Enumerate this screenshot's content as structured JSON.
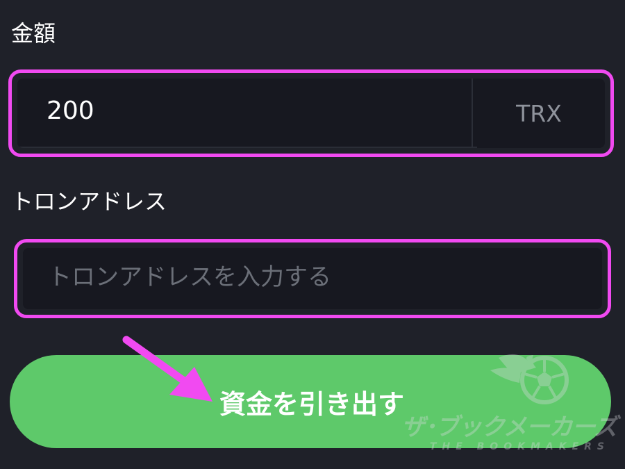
{
  "amount": {
    "label": "金額",
    "value": "200",
    "unit": "TRX"
  },
  "address": {
    "label": "トロンアドレス",
    "placeholder": "トロンアドレスを入力する",
    "value": ""
  },
  "withdraw_button": {
    "label": "資金を引き出す"
  },
  "watermark": {
    "title": "ザ･ブックメーカーズ",
    "subtitle": "THE BOOKMAKERS"
  },
  "colors": {
    "background": "#1f2129",
    "field": "#171820",
    "highlight": "#f14af1",
    "button": "#5ec96a",
    "arrow": "#f14af1"
  },
  "icons": {
    "watermark_logo": "soccer-ball-flame-icon",
    "annotation_arrow": "arrow-down-right-icon"
  }
}
